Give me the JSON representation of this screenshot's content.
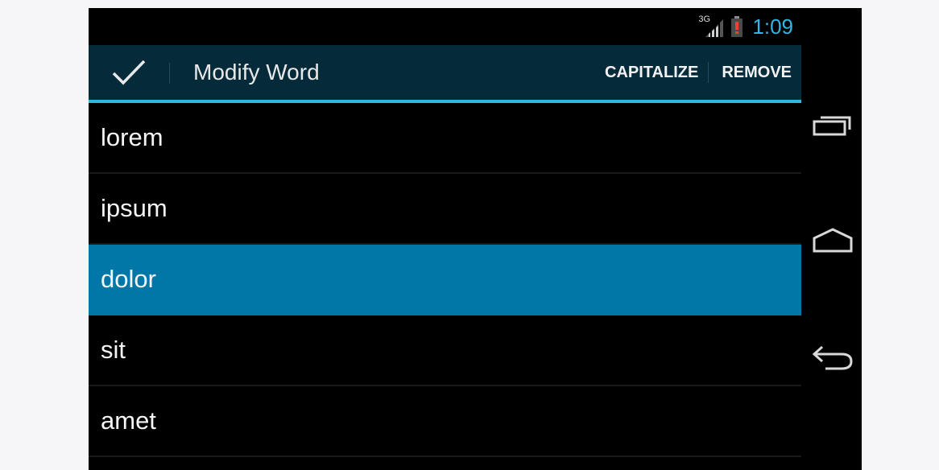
{
  "status_bar": {
    "network_type": "3G",
    "time": "1:09",
    "icons": [
      "signal-icon",
      "battery-alert-icon"
    ]
  },
  "action_bar": {
    "done_icon": "checkmark-icon",
    "title": "Modify Word",
    "actions": [
      {
        "label": "CAPITALIZE"
      },
      {
        "label": "REMOVE"
      }
    ]
  },
  "list": {
    "items": [
      {
        "label": "lorem",
        "selected": false
      },
      {
        "label": "ipsum",
        "selected": false
      },
      {
        "label": "dolor",
        "selected": true
      },
      {
        "label": "sit",
        "selected": false
      },
      {
        "label": "amet",
        "selected": false
      }
    ]
  },
  "nav_bar": {
    "buttons": [
      "recent-apps-icon",
      "home-icon",
      "back-icon"
    ]
  },
  "colors": {
    "accent": "#33b5e5",
    "action_bar_bg": "#052b3a",
    "selected_row": "#0077a6",
    "background": "#000000"
  }
}
